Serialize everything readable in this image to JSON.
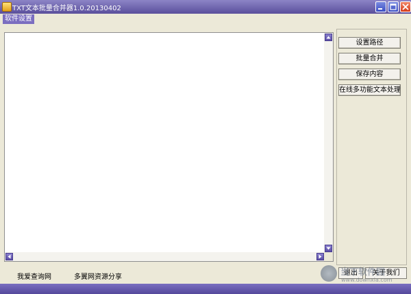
{
  "window": {
    "title": "TXT文本批量合并器1.0.20130402",
    "icon": "app-icon",
    "controls": [
      "minimize-icon",
      "maximize-icon",
      "close-icon"
    ]
  },
  "menu": {
    "items": [
      {
        "label": "软件设置"
      }
    ]
  },
  "editor": {
    "content": ""
  },
  "side_buttons": [
    {
      "label": "设置路径"
    },
    {
      "label": "批量合并"
    },
    {
      "label": "保存内容"
    },
    {
      "label": "在线多功能文本处理"
    }
  ],
  "status": {
    "link1": "我爱查询网",
    "link2": "多翼网资源分享"
  },
  "bottom_buttons": {
    "exit": "退出",
    "about": "关于我们"
  },
  "watermark": {
    "site": "当下软件园",
    "url": "www.downxia.com"
  },
  "colors": {
    "title_bar": "#6a5fb0",
    "menu_highlight": "#7b6ec0",
    "window_bg": "#ece9d8",
    "scroll_button": "#6b5fb5"
  }
}
